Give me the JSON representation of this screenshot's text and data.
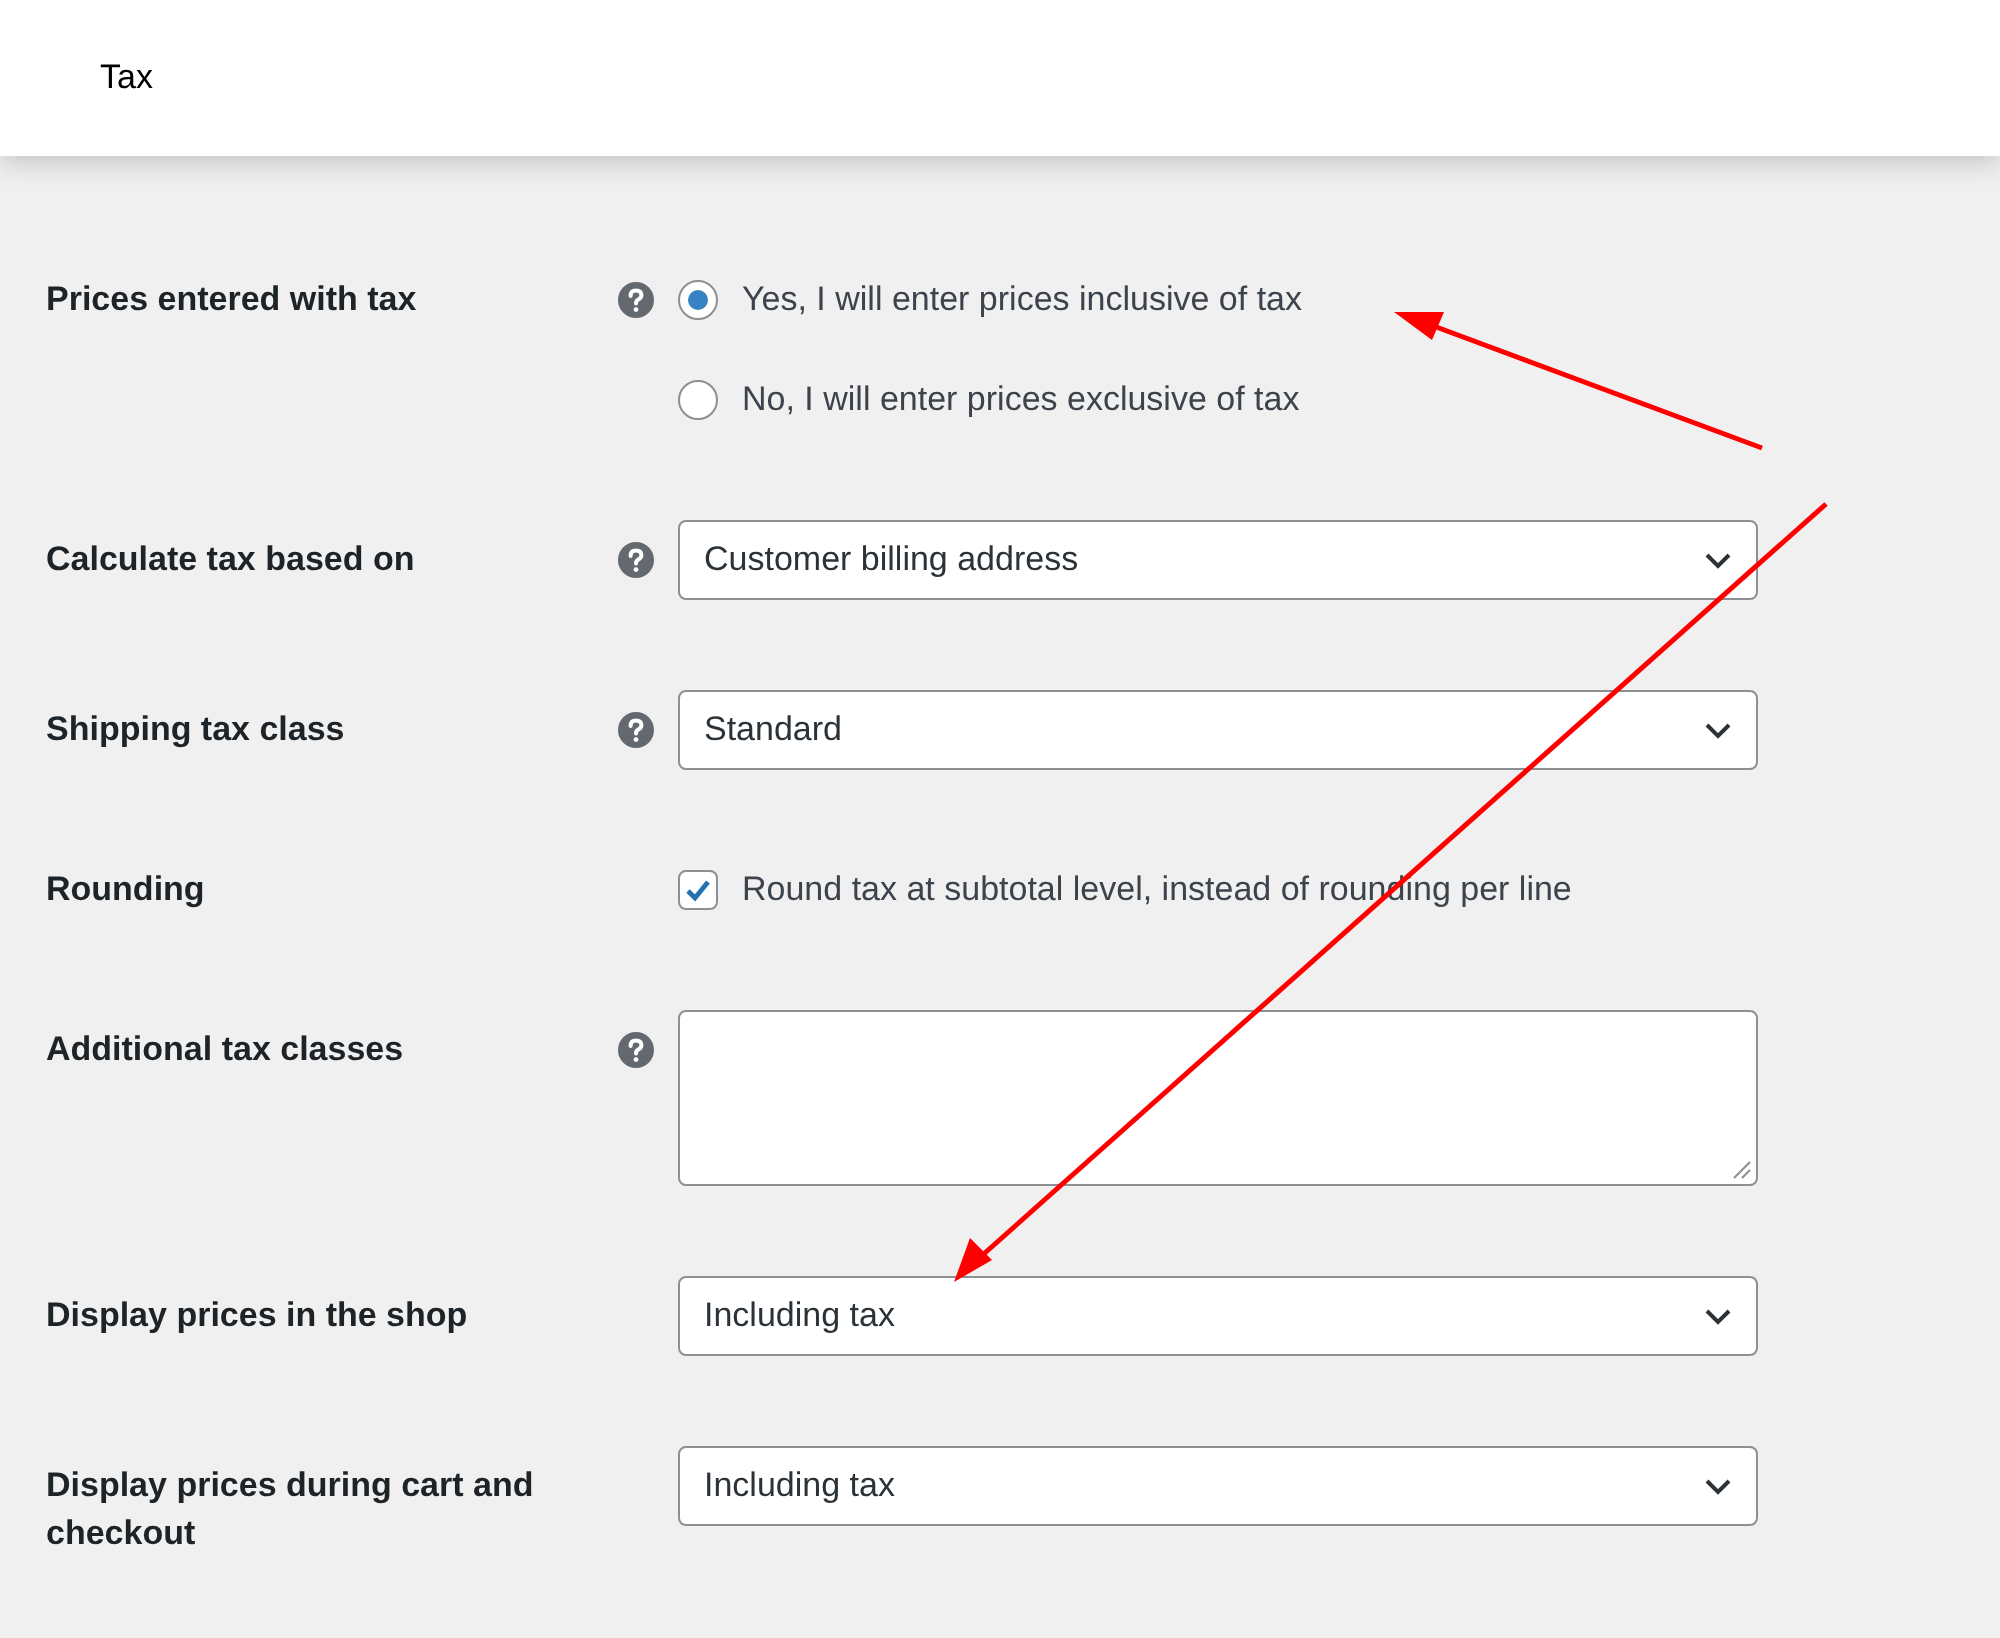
{
  "header": {
    "title": "Tax"
  },
  "fields": [
    {
      "kind": "radio",
      "label": "Prices entered with tax",
      "help": true,
      "options": [
        {
          "label": "Yes, I will enter prices inclusive of tax",
          "selected": true
        },
        {
          "label": "No, I will enter prices exclusive of tax",
          "selected": false
        }
      ]
    },
    {
      "kind": "select",
      "label": "Calculate tax based on",
      "help": true,
      "value": "Customer billing address"
    },
    {
      "kind": "select",
      "label": "Shipping tax class",
      "help": true,
      "value": "Standard"
    },
    {
      "kind": "checkbox",
      "label": "Rounding",
      "help": false,
      "checked": true,
      "text": "Round tax at subtotal level, instead of rounding per line"
    },
    {
      "kind": "textarea",
      "label": "Additional tax classes",
      "help": true
    },
    {
      "kind": "select",
      "label": "Display prices in the shop",
      "help": false,
      "value": "Including tax"
    },
    {
      "kind": "select",
      "label": "Display prices during cart and checkout",
      "help": false,
      "value": "Including tax"
    }
  ]
}
